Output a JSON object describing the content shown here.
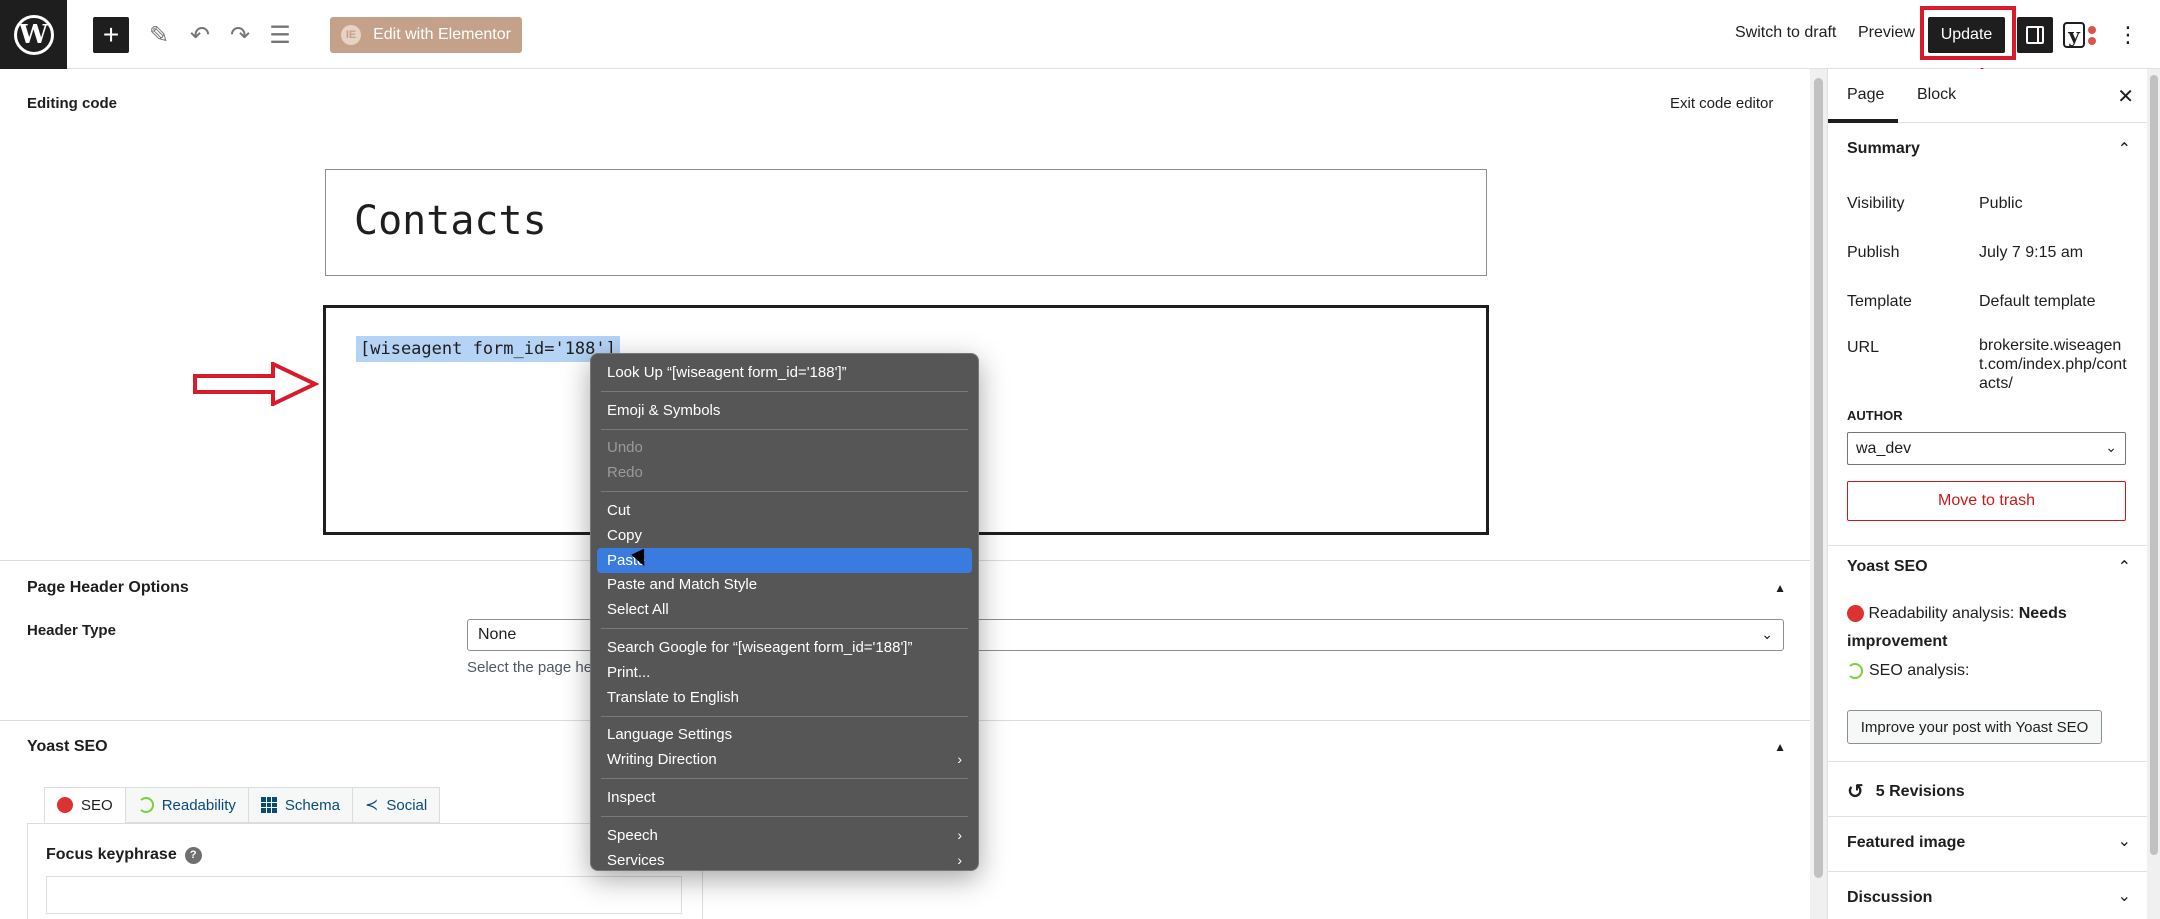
{
  "toolbar": {
    "elementor_label": "Edit with Elementor",
    "switch_draft": "Switch to draft",
    "preview": "Preview",
    "update": "Update"
  },
  "editor": {
    "mode_label": "Editing code",
    "exit_label": "Exit code editor",
    "title": "Contacts",
    "code": "[wiseagent form_id='188']"
  },
  "page_header": {
    "heading": "Page Header Options",
    "header_type_label": "Header Type",
    "header_type_value": "None",
    "help_text": "Select the page he"
  },
  "yoast_box": {
    "heading": "Yoast SEO",
    "tabs": [
      {
        "label": "SEO",
        "icon": "red-dot-icon"
      },
      {
        "label": "Readability",
        "icon": "spinner-icon"
      },
      {
        "label": "Schema",
        "icon": "grid-icon"
      },
      {
        "label": "Social",
        "icon": "share-icon"
      }
    ],
    "focus_label": "Focus keyphrase"
  },
  "sidebar": {
    "tab_page": "Page",
    "tab_block": "Block",
    "summary": "Summary",
    "rows": [
      {
        "label": "Visibility",
        "value": "Public"
      },
      {
        "label": "Publish",
        "value": "July 7 9:15 am"
      },
      {
        "label": "Template",
        "value": "Default template"
      }
    ],
    "url_label": "URL",
    "url_value": "brokersite.wiseagent.com/index.php/contacts/",
    "author_label": "AUTHOR",
    "author_value": "wa_dev",
    "trash": "Move to trash",
    "yoast_heading": "Yoast SEO",
    "readability_prefix": "Readability analysis: ",
    "readability_status": "Needs improvement",
    "seo_analysis": "SEO analysis:",
    "improve_btn": "Improve your post with Yoast SEO",
    "revisions": "5 Revisions",
    "featured_image": "Featured image",
    "discussion": "Discussion"
  },
  "context_menu": {
    "items": [
      {
        "label": "Look Up “[wiseagent form_id='188']”"
      },
      {
        "sep": true
      },
      {
        "label": "Emoji & Symbols"
      },
      {
        "sep": true
      },
      {
        "label": "Undo",
        "disabled": true
      },
      {
        "label": "Redo",
        "disabled": true
      },
      {
        "sep": true
      },
      {
        "label": "Cut"
      },
      {
        "label": "Copy"
      },
      {
        "label": "Paste",
        "highlighted": true
      },
      {
        "label": "Paste and Match Style"
      },
      {
        "label": "Select All"
      },
      {
        "sep": true
      },
      {
        "label": "Search Google for “[wiseagent form_id='188']”"
      },
      {
        "label": "Print..."
      },
      {
        "label": "Translate to English"
      },
      {
        "sep": true
      },
      {
        "label": "Language Settings"
      },
      {
        "label": "Writing Direction",
        "submenu": true
      },
      {
        "sep": true
      },
      {
        "label": "Inspect"
      },
      {
        "sep": true
      },
      {
        "label": "Speech",
        "submenu": true
      },
      {
        "label": "Services",
        "submenu": true
      }
    ]
  },
  "colors": {
    "annotation_red": "#d91a2a",
    "menu_highlight": "#3a7be0",
    "elementor": "#c5a189",
    "trash": "#cc1818"
  }
}
